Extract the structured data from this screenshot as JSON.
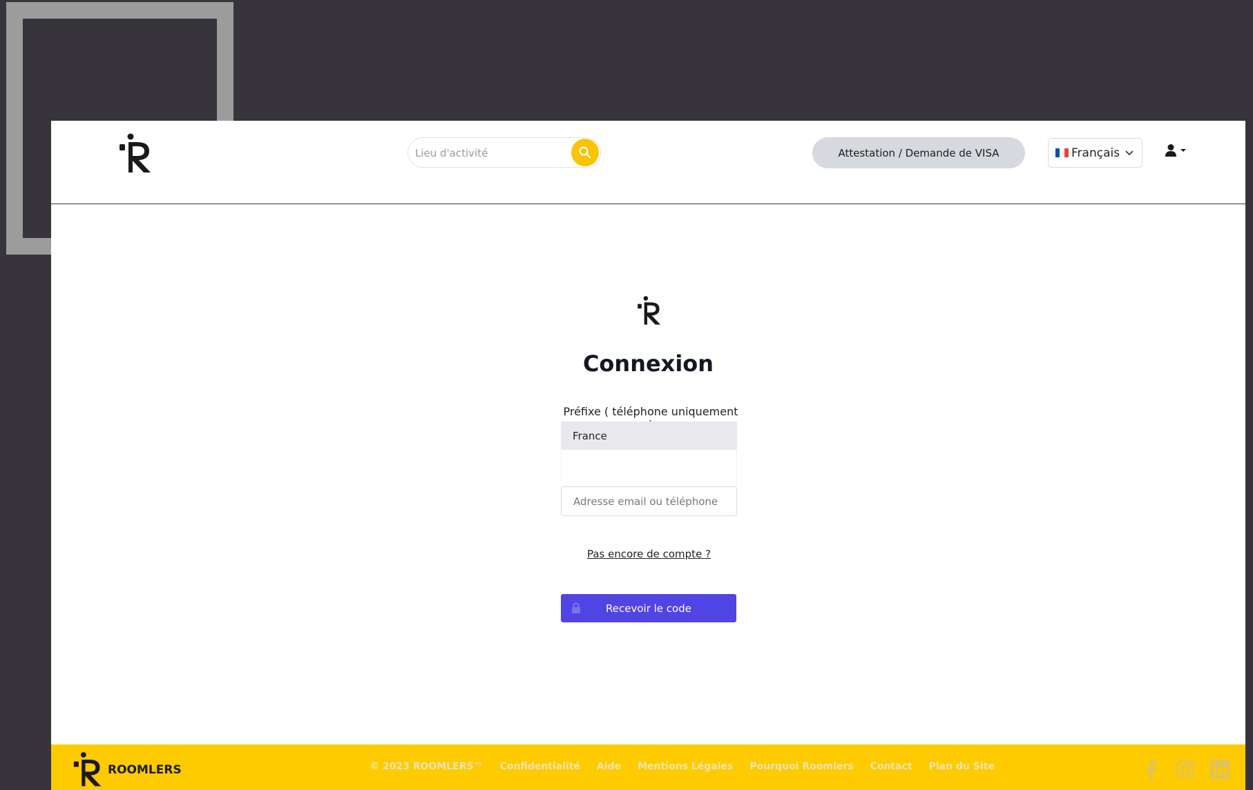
{
  "header": {
    "search": {
      "placeholder": "Lieu d'activité"
    },
    "visa_button": "Attestation / Demande de VISA",
    "language": {
      "selected": "Français",
      "flag": [
        "#0055a4",
        "#ffffff",
        "#ef4135"
      ]
    }
  },
  "login": {
    "title": "Connexion",
    "prefix_label": "Préfixe ( téléphone uniquement )",
    "country_selected": "France",
    "email_placeholder": "Adresse email ou téléphone",
    "signup_link": "Pas encore de compte ?",
    "submit_label": "Recevoir le code"
  },
  "footer": {
    "brand": "ROOMLERS",
    "links": [
      "© 2023 ROOMLERS™",
      "Confidentialité",
      "Aide",
      "Mentions Légales",
      "Pourquoi Roomlers",
      "Contact",
      "Plan du Site"
    ],
    "social": [
      "facebook-icon",
      "instagram-icon",
      "linkedin-icon"
    ]
  },
  "colors": {
    "accent_yellow": "#fecb00",
    "primary_button": "#5044e5",
    "backdrop": "#37343b",
    "footer_link": "#ede3b8"
  }
}
